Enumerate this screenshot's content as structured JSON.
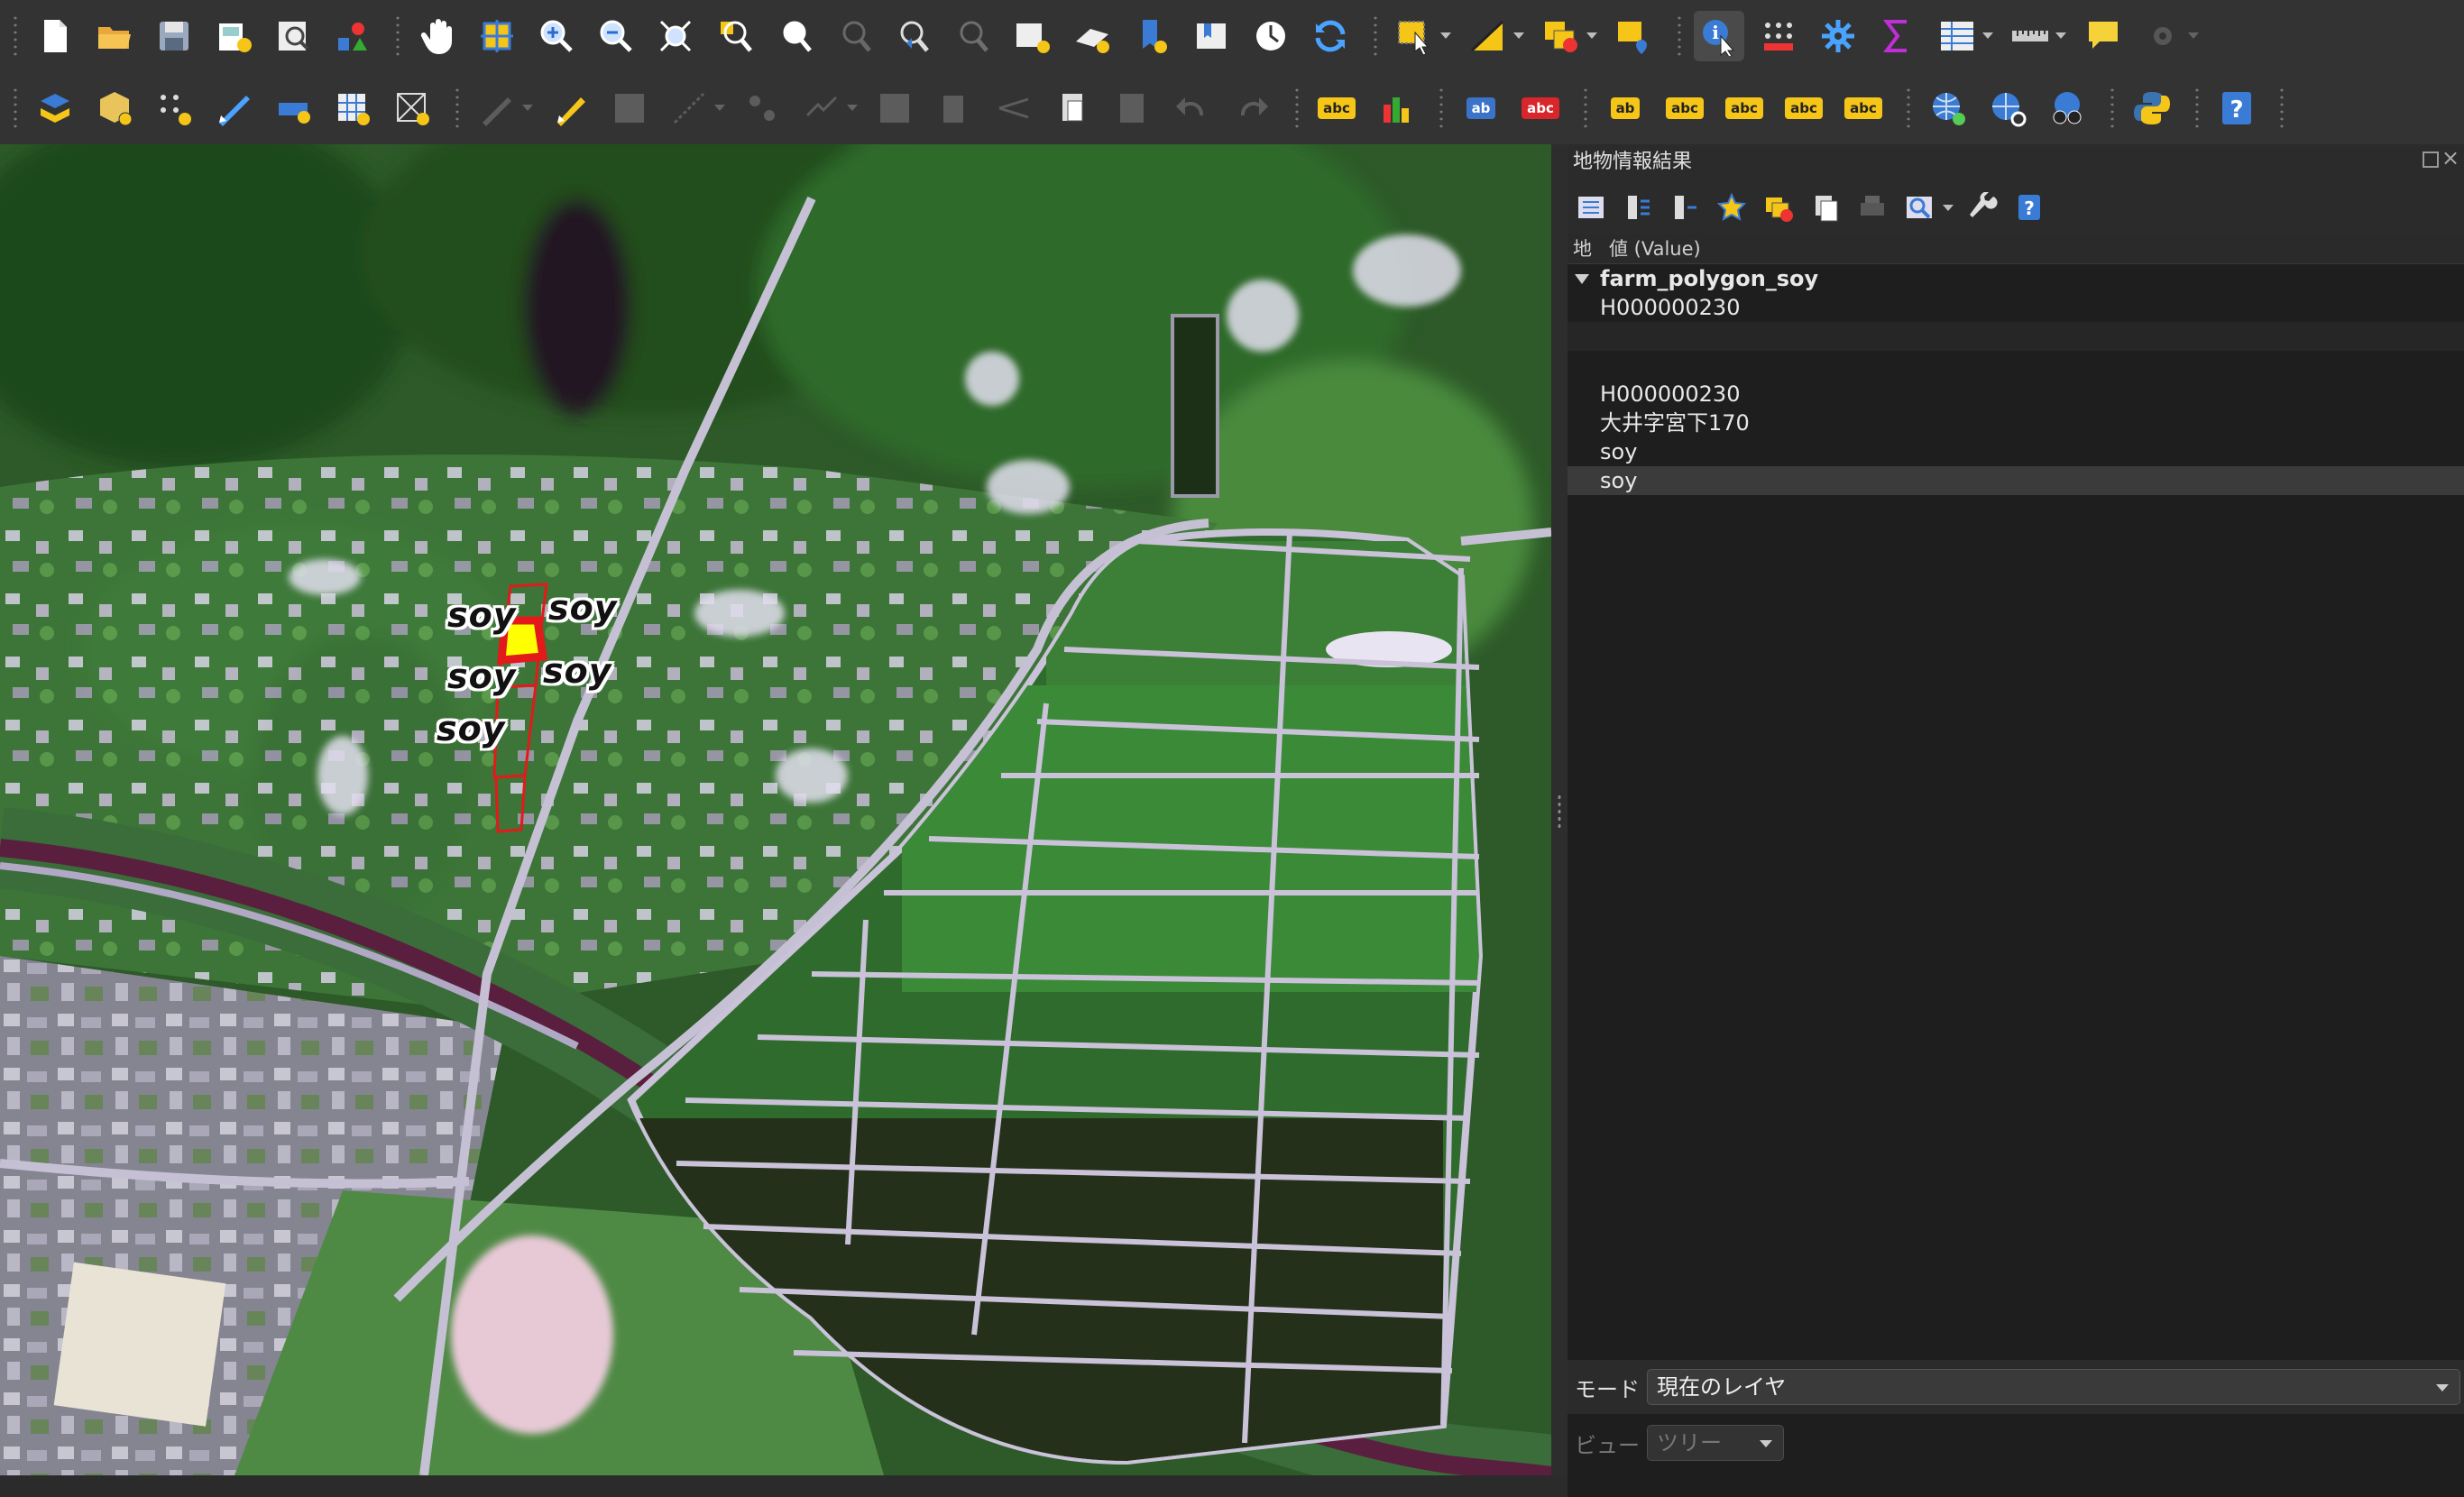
{
  "toolbar1": {
    "tools": [
      "new-project-icon",
      "open-project-icon",
      "save-project-icon",
      "new-print-layout-icon",
      "layout-manager-icon",
      "style-manager-icon",
      "pan-icon",
      "pan-to-selection-icon",
      "zoom-in-icon",
      "zoom-out-icon",
      "zoom-full-icon",
      "zoom-to-selection-icon",
      "zoom-to-layer-icon",
      "zoom-native-icon",
      "zoom-last-icon",
      "zoom-next-icon",
      "new-map-view-icon",
      "new-3d-view-icon",
      "new-bookmark-icon",
      "show-bookmarks-icon",
      "temporal-controller-icon",
      "refresh-icon",
      "select-features-icon",
      "select-by-expression-icon",
      "deselect-icon",
      "select-by-location-icon",
      "identify-features-icon",
      "open-attribute-table-stats-icon",
      "toolbox-gear-icon",
      "statistical-summary-icon",
      "attribute-table-icon",
      "measure-ruler-icon",
      "map-tips-icon",
      "settings-gear-icon"
    ]
  },
  "toolbar2": {
    "tools": [
      "data-source-manager-icon",
      "new-geopackage-layer-icon",
      "new-scratch-layer-icon",
      "digitize-icon",
      "add-vector-layer-icon",
      "add-raster-layer-icon",
      "add-mesh-layer-icon",
      "current-edits-icon",
      "toggle-editing-icon",
      "save-edits-icon",
      "digitize-with-segment-icon",
      "vertex-tool-icon",
      "modify-attributes-icon",
      "delete-selected-icon",
      "cut-features-icon",
      "copy-features-icon",
      "paste-features-icon",
      "undo-icon",
      "redo-icon",
      "label-tool-icon",
      "diagram-tool-icon",
      "pin-labels-icon",
      "highlight-pinned-labels-icon",
      "show-hide-labels-icon",
      "move-label-icon",
      "rotate-label-icon",
      "change-label-icon",
      "change-label-properties-icon",
      "wms-layer-icon",
      "wfs-layer-icon",
      "metasearch-icon",
      "python-console-icon",
      "help-icon"
    ],
    "label_abc": "abc",
    "label_ab": "ab"
  },
  "map": {
    "labels": [
      "soy",
      "soy",
      "soy",
      "soy",
      "soy"
    ],
    "colors": {
      "polygon_fill": "#ffff00",
      "polygon_outline": "#e31a1c"
    }
  },
  "panel": {
    "title": "地物情報結果",
    "header": {
      "col1": "地",
      "col2": "値 (Value)"
    },
    "layer_name": "farm_polygon_soy",
    "rows": [
      "H000000230",
      "",
      "",
      "H000000230",
      "大井字宮下170",
      "soy",
      "soy"
    ],
    "mode_label": "モード",
    "mode_value": "現在のレイヤ",
    "view_label": "ビュー",
    "view_value": "ツリー"
  }
}
